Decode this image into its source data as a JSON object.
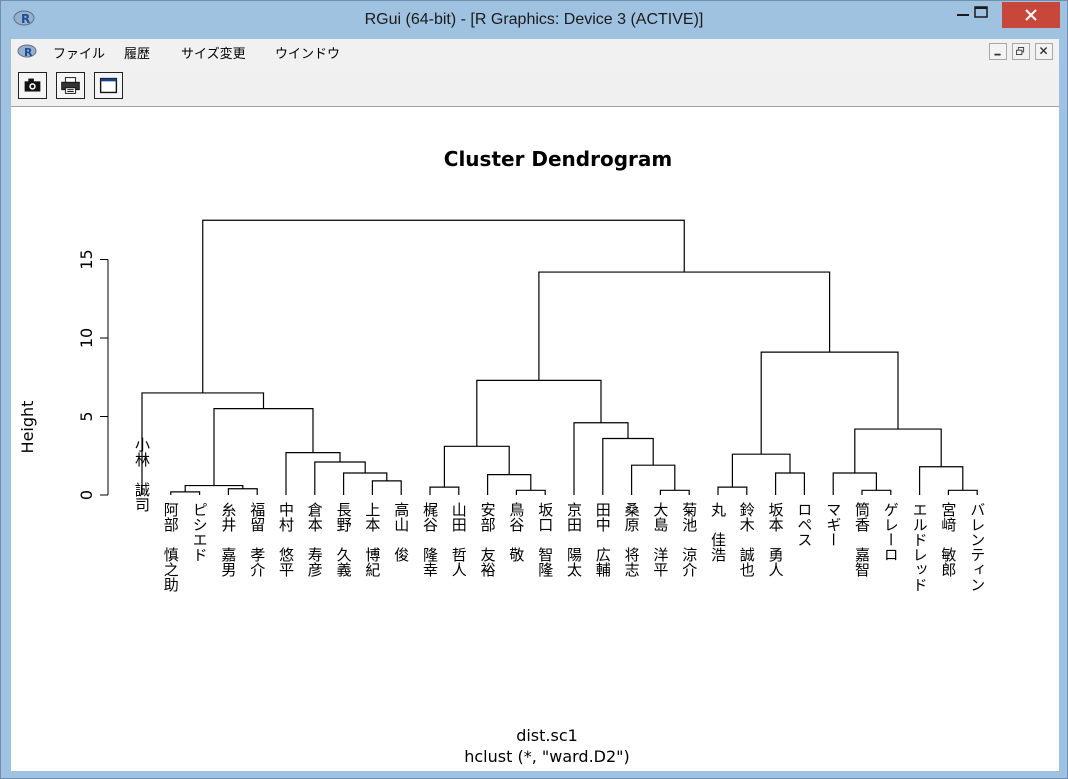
{
  "window": {
    "title": "RGui (64-bit) - [R Graphics: Device 3 (ACTIVE)]",
    "icon": "r-logo-icon",
    "controls": [
      "minimize-icon",
      "maximize-icon",
      "close-icon"
    ]
  },
  "menubar": {
    "items": [
      "ファイル",
      "履歴",
      "サイズ変更",
      "ウインドウ"
    ],
    "mdi_controls": [
      "mdi-minimize-icon",
      "mdi-restore-icon",
      "mdi-close-icon"
    ]
  },
  "toolbar": {
    "buttons": [
      "camera-icon",
      "printer-icon",
      "console-icon"
    ]
  },
  "chart_data": {
    "type": "dendrogram",
    "title": "Cluster Dendrogram",
    "ylabel": "Height",
    "xlabel": "dist.sc1",
    "sub": "hclust (*, \"ward.D2\")",
    "ylim": [
      0,
      18
    ],
    "yticks": [
      0,
      5,
      10,
      15
    ],
    "leaves": [
      "小林　誠司",
      "阿部　慎之助",
      "ピシエド",
      "糸井　嘉男",
      "福留　孝介",
      "中村　悠平",
      "倉本　寿彦",
      "長野　久義",
      "上本　博紀",
      "高山　俊",
      "梶谷　隆幸",
      "山田　哲人",
      "安部　友裕",
      "鳥谷　敬",
      "坂口　智隆",
      "京田　陽太",
      "田中　広輔",
      "桑原　将志",
      "大島　洋平",
      "菊池　涼介",
      "丸　佳浩",
      "鈴木　誠也",
      "坂本　勇人",
      "ロペス",
      "マギー",
      "筒香　嘉智",
      "ゲレーロ",
      "エルドレッド",
      "宮﨑　敏郎",
      "バレンティン"
    ],
    "merges": [
      {
        "a": [
          2,
          0
        ],
        "b": [
          3,
          0
        ],
        "height": 0.2
      },
      {
        "a": [
          4,
          0
        ],
        "b": [
          5,
          0
        ],
        "height": 0.4
      },
      {
        "a": [
          1,
          0
        ],
        "b": [
          1,
          1
        ],
        "height": 0.6
      },
      {
        "a": [
          9,
          0
        ],
        "b": [
          10,
          0
        ],
        "height": 0.9
      },
      {
        "a": [
          8,
          0
        ],
        "b": [
          9,
          1
        ],
        "height": 1.4
      },
      {
        "a": [
          7,
          0
        ],
        "b": [
          8,
          1
        ],
        "height": 2.1
      },
      {
        "a": [
          6,
          0
        ],
        "b": [
          7,
          1
        ],
        "height": 2.7
      },
      {
        "a": [
          0,
          0
        ],
        "b": [
          6,
          1
        ],
        "height": 5.5
      },
      {
        "a": [
          -1,
          0
        ],
        "b": [
          0,
          1
        ],
        "height": 6.5
      },
      {
        "a": [
          14,
          0
        ],
        "b": [
          15,
          0
        ],
        "height": 0.3
      },
      {
        "a": [
          13,
          0
        ],
        "b": [
          14,
          1
        ],
        "height": 1.3
      },
      {
        "a": [
          11,
          0
        ],
        "b": [
          12,
          0
        ],
        "height": 0.5
      },
      {
        "a": [
          11,
          1
        ],
        "b": [
          13,
          1
        ],
        "height": 3.1
      },
      {
        "a": [
          19,
          0
        ],
        "b": [
          20,
          0
        ],
        "height": 0.3
      },
      {
        "a": [
          18,
          0
        ],
        "b": [
          19,
          1
        ],
        "height": 1.9
      },
      {
        "a": [
          17,
          0
        ],
        "b": [
          18,
          1
        ],
        "height": 3.6
      },
      {
        "a": [
          16,
          0
        ],
        "b": [
          17,
          1
        ],
        "height": 4.6
      },
      {
        "a": [
          15,
          1
        ],
        "b": [
          16,
          1
        ],
        "height": 7.3
      },
      {
        "a": [
          21,
          0
        ],
        "b": [
          22,
          0
        ],
        "height": 0.5
      },
      {
        "a": [
          23,
          0
        ],
        "b": [
          24,
          0
        ],
        "height": 1.4
      },
      {
        "a": [
          21,
          1
        ],
        "b": [
          23,
          1
        ],
        "height": 2.6
      },
      {
        "a": [
          27,
          0
        ],
        "b": [
          28,
          0
        ],
        "height": 0.3
      },
      {
        "a": [
          26,
          0
        ],
        "b": [
          27,
          1
        ],
        "height": 1.4
      },
      {
        "a": [
          29,
          0
        ],
        "b": [
          30,
          0
        ],
        "height": 0.3
      },
      {
        "a": [
          28,
          1
        ],
        "b": [
          29,
          1
        ],
        "height": 1.8
      },
      {
        "a": [
          26,
          1
        ],
        "b": [
          28,
          2
        ],
        "height": 4.2
      },
      {
        "a": [
          25,
          0
        ],
        "b": [
          26,
          2
        ],
        "height": 9.1
      },
      {
        "a": [
          20,
          2
        ],
        "b": [
          25,
          1
        ],
        "height": 14.2
      },
      {
        "a": [
          0,
          2
        ],
        "b": [
          20,
          3
        ],
        "height": 17.5
      }
    ]
  }
}
